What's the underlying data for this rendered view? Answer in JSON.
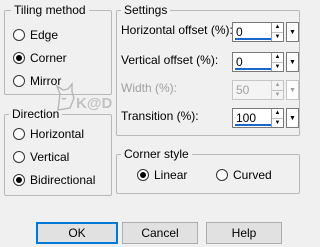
{
  "tiling_method": {
    "title": "Tiling method",
    "options": [
      {
        "label": "Edge",
        "checked": false
      },
      {
        "label": "Corner",
        "checked": true
      },
      {
        "label": "Mirror",
        "checked": false
      }
    ]
  },
  "direction": {
    "title": "Direction",
    "options": [
      {
        "label": "Horizontal",
        "checked": false
      },
      {
        "label": "Vertical",
        "checked": false
      },
      {
        "label": "Bidirectional",
        "checked": true
      }
    ]
  },
  "settings": {
    "title": "Settings",
    "fields": [
      {
        "label": "Horizontal offset (%):",
        "value": "0",
        "enabled": true,
        "level": 0
      },
      {
        "label": "Vertical offset (%):",
        "value": "0",
        "enabled": true,
        "level": 0
      },
      {
        "label": "Width (%):",
        "value": "50",
        "enabled": false,
        "level": 50
      },
      {
        "label": "Transition (%):",
        "value": "100",
        "enabled": true,
        "level": 100
      }
    ]
  },
  "corner_style": {
    "title": "Corner style",
    "options": [
      {
        "label": "Linear",
        "checked": true
      },
      {
        "label": "Curved",
        "checked": false
      }
    ]
  },
  "buttons": {
    "ok": "OK",
    "cancel": "Cancel",
    "help": "Help"
  },
  "watermark": {
    "text": "K@D",
    "icon": "cat-watermark-logo"
  }
}
